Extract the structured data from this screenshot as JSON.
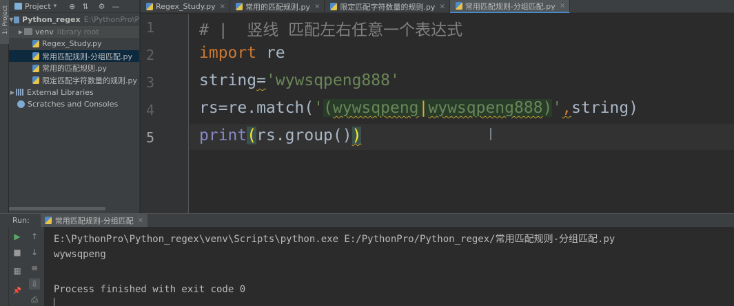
{
  "tool_strip": {
    "project_tab": "1: Project"
  },
  "project": {
    "header_label": "Project",
    "dropdown_arrow": "▾",
    "toolbar_icons": [
      "crosshair-icon",
      "collapse-icon",
      "gear-icon",
      "minimize-icon"
    ],
    "toolbar_glyphs": [
      "⊕",
      "⇅",
      "⚙",
      "—"
    ],
    "tree": {
      "root_name": "Python_regex",
      "root_path": "E:\\PythonPro\\P",
      "venv_name": "venv",
      "venv_note": "library root",
      "files": [
        "Regex_Study.py",
        "常用匹配规则-分组匹配.py",
        "常用的匹配规则.py",
        "限定匹配字符数量的规则.py"
      ],
      "external_libraries": "External Libraries",
      "scratches": "Scratches and Consoles"
    }
  },
  "tabs": [
    {
      "label": "Regex_Study.py",
      "active": false
    },
    {
      "label": "常用的匹配规则.py",
      "active": false
    },
    {
      "label": "限定匹配字符数量的规则.py",
      "active": false
    },
    {
      "label": "常用匹配规则-分组匹配.py",
      "active": true
    }
  ],
  "tab_close_glyph": "×",
  "editor": {
    "line_numbers": [
      "1",
      "2",
      "3",
      "4",
      "5"
    ],
    "current_line": 5,
    "line1": {
      "hash": "#",
      "bar": "|",
      "text": "竖线 匹配左右任意一个表达式"
    },
    "line2": {
      "keyword": "import",
      "module": "re"
    },
    "line3": {
      "var": "string",
      "eq": "=",
      "str": "'wywsqpeng888'"
    },
    "line4": {
      "prefix": "rs=re.match(",
      "q1": "'",
      "lp": "(",
      "alt1": "wywsqpeng",
      "bar": "|",
      "alt2": "wywsqpeng888",
      "rp": ")",
      "q2": "'",
      "comma": ",",
      "suffix": "string)"
    },
    "line5": {
      "builtin": "print",
      "lp": "(",
      "mid": "rs.group()",
      "rp": ")"
    }
  },
  "run": {
    "label": "Run:",
    "tab": "常用匹配规则-分组匹配",
    "toolbar": [
      "▶",
      "↑",
      "■",
      "↓",
      "▦",
      "≡",
      "⇩",
      "📌",
      "⎙"
    ],
    "console": {
      "command": "E:\\PythonPro\\Python_regex\\venv\\Scripts\\python.exe E:/PythonPro/Python_regex/常用匹配规则-分组匹配.py",
      "output": "wywsqpeng",
      "exit": "Process finished with exit code 0"
    }
  },
  "colors": {
    "keyword": "#cc7832",
    "string": "#6a8759",
    "comment": "#808080",
    "builtin": "#8888c6",
    "selection": "#0d293e",
    "tab_underline": "#4a88c7"
  }
}
